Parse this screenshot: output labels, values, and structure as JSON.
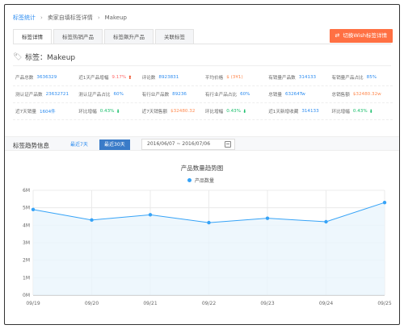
{
  "breadcrumb": [
    "标签统计",
    "卖家自填标签详情",
    "Makeup"
  ],
  "tabs": [
    {
      "label": "标签详情",
      "active": true
    },
    {
      "label": "标签热销产品",
      "active": false
    },
    {
      "label": "标签飙升产品",
      "active": false
    },
    {
      "label": "关联标签",
      "active": false
    }
  ],
  "switch_button": "切换Wish标签详情",
  "tag_title": "标签：Makeup",
  "stats": [
    [
      {
        "label": "产品总数",
        "value": "3636329"
      },
      {
        "label": "近1天产品增幅",
        "value": "9.17%",
        "tone": "red",
        "arrow": "up"
      },
      {
        "label": "评论数",
        "value": "8923831"
      },
      {
        "label": "平均价格",
        "value": "$ (3¥1)",
        "tone": "orange"
      },
      {
        "label": "有销量产品数",
        "value": "314133"
      },
      {
        "label": "有销量产品占比",
        "value": "85%"
      }
    ],
    [
      {
        "label": "测认证产品数",
        "value": "23632721"
      },
      {
        "label": "测认证产品占比",
        "value": "60%"
      },
      {
        "label": "有行业产品数",
        "value": "89236"
      },
      {
        "label": "有行业产品占比",
        "value": "60%"
      },
      {
        "label": "总销量",
        "value": "63264Tw"
      },
      {
        "label": "总销售额",
        "value": "$32480.32w",
        "tone": "orange"
      }
    ],
    [
      {
        "label": "近7天销量",
        "value": "1604件"
      },
      {
        "label": "环比增幅",
        "value": "0.43%",
        "tone": "green",
        "arrow": "down"
      },
      {
        "label": "近7天销售额",
        "value": "$32480.32",
        "tone": "orange"
      },
      {
        "label": "环比增幅",
        "value": "0.43%",
        "tone": "green",
        "arrow": "down"
      },
      {
        "label": "近1天新增收藏",
        "value": "314133"
      },
      {
        "label": "环比增幅",
        "value": "0.43%",
        "tone": "green",
        "arrow": "down"
      }
    ]
  ],
  "trend": {
    "title": "标签趋势信息",
    "period_7": "最近7天",
    "period_30": "最近30天",
    "date_range": "2016/06/07 ~ 2016/07/06"
  },
  "chart_data": {
    "type": "area",
    "title": "产品数量趋势图",
    "series": [
      {
        "name": "产品数量",
        "values": [
          4.9,
          4.3,
          4.6,
          4.15,
          4.4,
          4.2,
          5.3
        ]
      }
    ],
    "x": [
      "09/19",
      "09/20",
      "09/21",
      "09/22",
      "09/23",
      "09/24",
      "09/25"
    ],
    "y_ticks": [
      "0M",
      "1M",
      "2M",
      "3M",
      "4M",
      "5M",
      "6M"
    ],
    "ylim": [
      0,
      6
    ],
    "color": "#36a3f7",
    "grid": true
  }
}
